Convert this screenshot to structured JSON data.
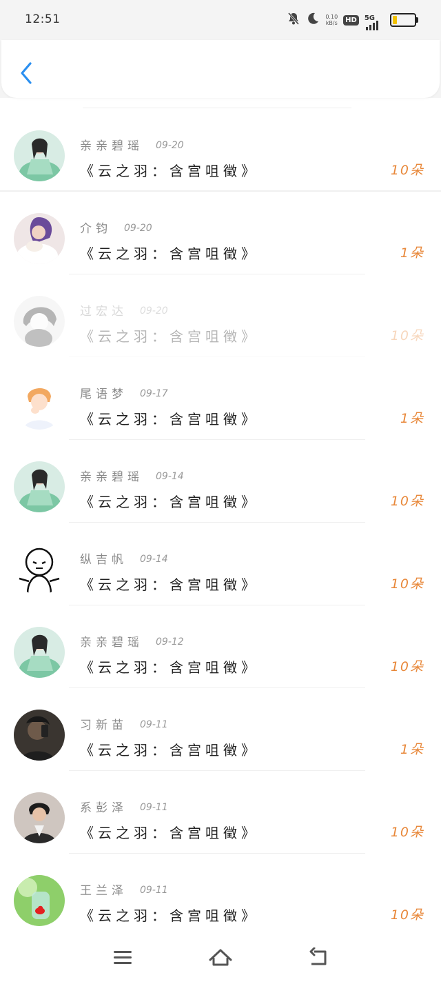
{
  "status_bar": {
    "time": "12:51",
    "net_speed_value": "0.10",
    "net_speed_unit": "kB/s",
    "hd_label": "HD",
    "network_label": "5G",
    "battery_level": 0.2,
    "icons": [
      "mute-bell-icon",
      "moon-icon",
      "signal-icon",
      "battery-icon"
    ]
  },
  "header": {
    "back_icon": "chevron-left-icon"
  },
  "colors": {
    "accent": "#2a8ff0",
    "count": "#e8883a",
    "name": "#8a8a8a"
  },
  "rows": [
    {
      "name": "亲亲碧瑶",
      "date": "09-20",
      "title": "《云之羽：含宫咀徵》",
      "count": "10朵"
    },
    {
      "name": "介钧",
      "date": "09-20",
      "title": "《云之羽：含宫咀徵》",
      "count": "1朵"
    },
    {
      "name": "过宏达",
      "date": "09-20",
      "title": "《云之羽：含宫咀徵》",
      "count": "10朵"
    },
    {
      "name": "尾语梦",
      "date": "09-17",
      "title": "《云之羽：含宫咀徵》",
      "count": "1朵"
    },
    {
      "name": "亲亲碧瑶",
      "date": "09-14",
      "title": "《云之羽：含宫咀徵》",
      "count": "10朵"
    },
    {
      "name": "纵吉帆",
      "date": "09-14",
      "title": "《云之羽：含宫咀徵》",
      "count": "10朵"
    },
    {
      "name": "亲亲碧瑶",
      "date": "09-12",
      "title": "《云之羽：含宫咀徵》",
      "count": "10朵"
    },
    {
      "name": "习新苗",
      "date": "09-11",
      "title": "《云之羽：含宫咀徵》",
      "count": "1朵"
    },
    {
      "name": "系彭泽",
      "date": "09-11",
      "title": "《云之羽：含宫咀徵》",
      "count": "10朵"
    },
    {
      "name": "王兰泽",
      "date": "09-11",
      "title": "《云之羽：含宫咀徵》",
      "count": "10朵"
    }
  ],
  "nav": {
    "icons": [
      "menu-icon",
      "home-icon",
      "back-icon"
    ]
  }
}
